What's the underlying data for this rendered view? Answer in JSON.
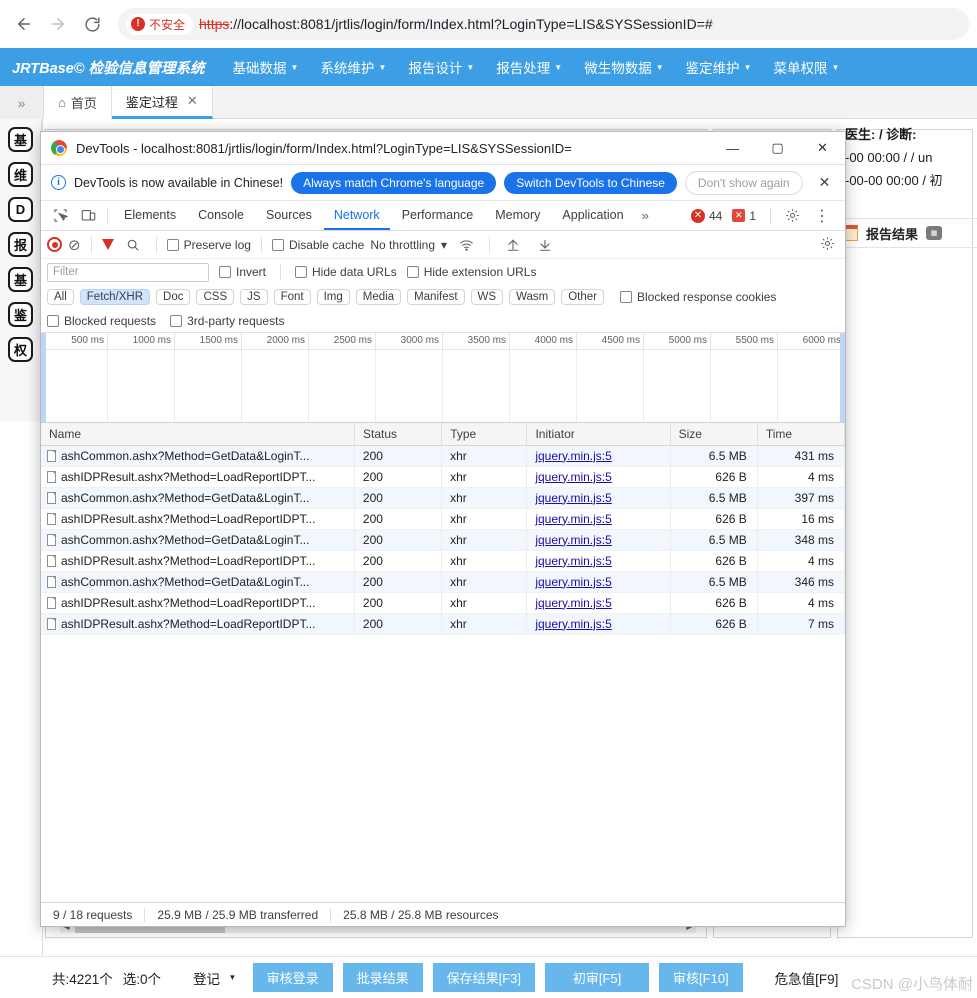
{
  "browser": {
    "back_icon": "back-arrow",
    "forward_icon": "forward-arrow",
    "reload_icon": "reload",
    "security_label": "不安全",
    "url_scheme": "https",
    "url_rest": "://localhost:8081/jrtlis/login/form/Index.html?LoginType=LIS&SYSSessionID=#"
  },
  "app": {
    "logo": "JRTBase© 检验信息管理系统",
    "menu": [
      {
        "label": "基础数据"
      },
      {
        "label": "系统维护"
      },
      {
        "label": "报告设计"
      },
      {
        "label": "报告处理"
      },
      {
        "label": "微生物数据"
      },
      {
        "label": "鉴定维护"
      },
      {
        "label": "菜单权限"
      }
    ],
    "collapse_icon": "chevron-double-right",
    "tabs": [
      {
        "label": "首页",
        "icon": "home-icon",
        "active": false,
        "closable": false
      },
      {
        "label": "鉴定过程",
        "icon": "",
        "active": true,
        "closable": true
      }
    ],
    "rail_icons": [
      "基",
      "维",
      "D",
      "报",
      "基",
      "鉴",
      "权"
    ],
    "right_panel": {
      "line1": "医生:  /  诊断:",
      "line2": "-00 00:00 /   /  un",
      "line3": "-00-00 00:00  / 初",
      "report_label": "报告结果"
    }
  },
  "devtools": {
    "window_title": "DevTools - localhost:8081/jrtlis/login/form/Index.html?LoginType=LIS&SYSSessionID=",
    "minimize_label": "—",
    "maximize_label": "▢",
    "close_label": "✕",
    "banner": {
      "message": "DevTools is now available in Chinese!",
      "primary_btn": "Always match Chrome's language",
      "secondary_btn": "Switch DevTools to Chinese",
      "dismiss_btn": "Don't show again",
      "close_icon": "close-icon"
    },
    "tabs": [
      {
        "label": "Elements",
        "active": false
      },
      {
        "label": "Console",
        "active": false
      },
      {
        "label": "Sources",
        "active": false
      },
      {
        "label": "Network",
        "active": true
      },
      {
        "label": "Performance",
        "active": false
      },
      {
        "label": "Memory",
        "active": false
      },
      {
        "label": "Application",
        "active": false
      }
    ],
    "more_tabs_icon": "chevron-double-right",
    "error_count": "44",
    "warning_count": "1",
    "settings_icon": "gear-icon",
    "menu_icon": "kebab-menu-icon",
    "toolbar": {
      "record_icon": "record-icon",
      "clear_icon": "clear-icon",
      "filter_icon": "filter-icon",
      "search_icon": "search-icon",
      "preserve_log": "Preserve log",
      "disable_cache": "Disable cache",
      "throttling": "No throttling",
      "throttle_caret": "▾",
      "wifi_icon": "wifi-icon",
      "import_icon": "upload-icon",
      "export_icon": "download-icon",
      "settings_icon": "gear-icon"
    },
    "filterbar": {
      "filter_placeholder": "Filter",
      "invert": "Invert",
      "hide_data_urls": "Hide data URLs",
      "hide_extension_urls": "Hide extension URLs"
    },
    "type_chips": [
      {
        "label": "All",
        "active": false
      },
      {
        "label": "Fetch/XHR",
        "active": true
      },
      {
        "label": "Doc",
        "active": false
      },
      {
        "label": "CSS",
        "active": false
      },
      {
        "label": "JS",
        "active": false
      },
      {
        "label": "Font",
        "active": false
      },
      {
        "label": "Img",
        "active": false
      },
      {
        "label": "Media",
        "active": false
      },
      {
        "label": "Manifest",
        "active": false
      },
      {
        "label": "WS",
        "active": false
      },
      {
        "label": "Wasm",
        "active": false
      },
      {
        "label": "Other",
        "active": false
      }
    ],
    "blocked_response_cookies": "Blocked response cookies",
    "blocked_requests": "Blocked requests",
    "third_party_requests": "3rd-party requests",
    "timeline_ticks": [
      "500 ms",
      "1000 ms",
      "1500 ms",
      "2000 ms",
      "2500 ms",
      "3000 ms",
      "3500 ms",
      "4000 ms",
      "4500 ms",
      "5000 ms",
      "5500 ms",
      "6000 ms"
    ],
    "table": {
      "columns": [
        "Name",
        "Status",
        "Type",
        "Initiator",
        "Size",
        "Time"
      ],
      "rows": [
        {
          "name": "ashCommon.ashx?Method=GetData&LoginT...",
          "status": "200",
          "type": "xhr",
          "initiator": "jquery.min.js:5",
          "size": "6.5 MB",
          "time": "431 ms"
        },
        {
          "name": "ashIDPResult.ashx?Method=LoadReportIDPT...",
          "status": "200",
          "type": "xhr",
          "initiator": "jquery.min.js:5",
          "size": "626 B",
          "time": "4 ms"
        },
        {
          "name": "ashCommon.ashx?Method=GetData&LoginT...",
          "status": "200",
          "type": "xhr",
          "initiator": "jquery.min.js:5",
          "size": "6.5 MB",
          "time": "397 ms"
        },
        {
          "name": "ashIDPResult.ashx?Method=LoadReportIDPT...",
          "status": "200",
          "type": "xhr",
          "initiator": "jquery.min.js:5",
          "size": "626 B",
          "time": "16 ms"
        },
        {
          "name": "ashCommon.ashx?Method=GetData&LoginT...",
          "status": "200",
          "type": "xhr",
          "initiator": "jquery.min.js:5",
          "size": "6.5 MB",
          "time": "348 ms"
        },
        {
          "name": "ashIDPResult.ashx?Method=LoadReportIDPT...",
          "status": "200",
          "type": "xhr",
          "initiator": "jquery.min.js:5",
          "size": "626 B",
          "time": "4 ms"
        },
        {
          "name": "ashCommon.ashx?Method=GetData&LoginT...",
          "status": "200",
          "type": "xhr",
          "initiator": "jquery.min.js:5",
          "size": "6.5 MB",
          "time": "346 ms"
        },
        {
          "name": "ashIDPResult.ashx?Method=LoadReportIDPT...",
          "status": "200",
          "type": "xhr",
          "initiator": "jquery.min.js:5",
          "size": "626 B",
          "time": "4 ms"
        },
        {
          "name": "ashIDPResult.ashx?Method=LoadReportIDPT...",
          "status": "200",
          "type": "xhr",
          "initiator": "jquery.min.js:5",
          "size": "626 B",
          "time": "7 ms"
        }
      ]
    },
    "status_bar": {
      "requests": "9 / 18 requests",
      "transferred": "25.9 MB / 25.9 MB transferred",
      "resources": "25.8 MB / 25.8 MB resources"
    }
  },
  "bottombar": {
    "total_text": "共:4221个",
    "selected_text": "选:0个",
    "dropdown_label": "登记",
    "dropdown_caret": "▾",
    "buttons": [
      {
        "label": "审核登录"
      },
      {
        "label": "批录结果"
      },
      {
        "label": "保存结果[F3]"
      },
      {
        "label": "初审[F5]"
      },
      {
        "label": "审核[F10]"
      }
    ],
    "critical_label": "危急值[F9]",
    "watermark": "CSDN @小鸟体耐"
  },
  "colors": {
    "app_blue": "#3c9ee5",
    "devtools_blue": "#1a73e8",
    "button_blue": "#67b7ec",
    "danger_red": "#d93025"
  }
}
